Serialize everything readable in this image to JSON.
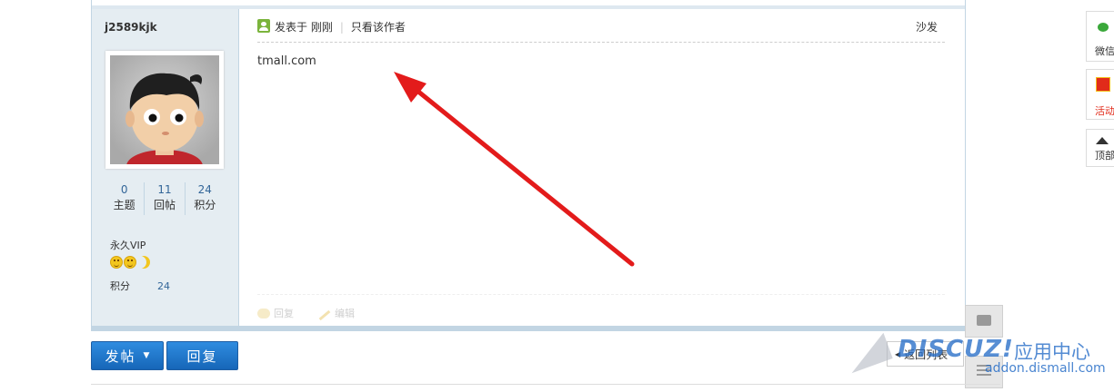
{
  "author": {
    "name": "j2589kjk",
    "stats": [
      {
        "value": "0",
        "label": "主题"
      },
      {
        "value": "11",
        "label": "回帖"
      },
      {
        "value": "24",
        "label": "积分"
      }
    ],
    "group": "永久VIP",
    "credits_label": "积分",
    "credits_value": "24"
  },
  "post": {
    "posted_label": "发表于 刚刚",
    "only_author": "只看该作者",
    "floor": "沙发",
    "content": "tmall.com",
    "actions": {
      "reply": "回复",
      "edit": "编辑"
    }
  },
  "toolbar": {
    "post_button": "发帖",
    "reply_button": "回复",
    "back_to_list": "返回列表"
  },
  "watermark": {
    "logo": "DISCUZ!",
    "cn": "应用中心",
    "url": "addon.dismall.com"
  },
  "right_sidebar": {
    "wechat": "微信",
    "event": "活动",
    "top": "顶部"
  },
  "colors": {
    "side_bg": "#e5edf2",
    "border": "#c2d5e3",
    "button_blue": "#1f74cc",
    "arrow_red": "#e31b1b"
  }
}
